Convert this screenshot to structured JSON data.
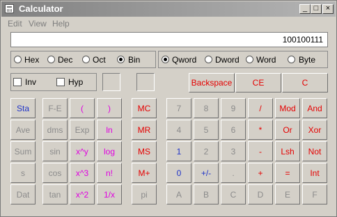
{
  "window": {
    "title": "Calculator",
    "controls": {
      "minimize": "_",
      "maximize": "□",
      "close": "×"
    }
  },
  "menu": [
    "Edit",
    "View",
    "Help"
  ],
  "display": {
    "value": "100100111"
  },
  "number_base": {
    "options": [
      "Hex",
      "Dec",
      "Oct",
      "Bin"
    ],
    "selected": "Bin"
  },
  "word_size": {
    "options": [
      "Qword",
      "Dword",
      "Word",
      "Byte"
    ],
    "selected": "Qword"
  },
  "checkboxes": {
    "inv": "Inv",
    "hyp": "Hyp"
  },
  "buttons": {
    "backspace": "Backspace",
    "ce": "CE",
    "c": "C",
    "rows": [
      [
        "Sta",
        "F-E",
        "(",
        ")",
        "MC",
        "7",
        "8",
        "9",
        "/",
        "Mod",
        "And"
      ],
      [
        "Ave",
        "dms",
        "Exp",
        "ln",
        "MR",
        "4",
        "5",
        "6",
        "*",
        "Or",
        "Xor"
      ],
      [
        "Sum",
        "sin",
        "x^y",
        "log",
        "MS",
        "1",
        "2",
        "3",
        "-",
        "Lsh",
        "Not"
      ],
      [
        "s",
        "cos",
        "x^3",
        "n!",
        "M+",
        "0",
        "+/-",
        ".",
        "+",
        "=",
        "Int"
      ],
      [
        "Dat",
        "tan",
        "x^2",
        "1/x",
        "pi",
        "A",
        "B",
        "C",
        "D",
        "E",
        "F"
      ]
    ]
  },
  "colors": {
    "blue": "#1f33c8",
    "red": "#e50000",
    "magenta": "#e000e0",
    "gray": "#8b8b8b",
    "face": "#d4d0c8"
  }
}
